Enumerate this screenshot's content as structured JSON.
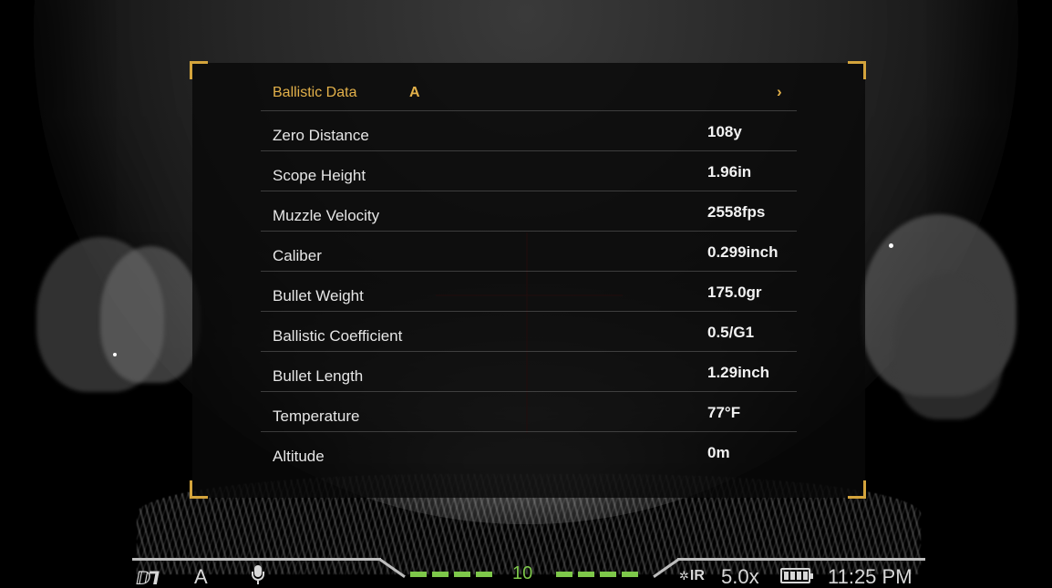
{
  "menu": {
    "title": "Ballistic Data",
    "profile": "A",
    "chevron": "›",
    "rows": [
      {
        "label": "Zero Distance",
        "value": "108y"
      },
      {
        "label": "Scope Height",
        "value": "1.96in"
      },
      {
        "label": "Muzzle Velocity",
        "value": "2558fps"
      },
      {
        "label": "Caliber",
        "value": "0.299inch"
      },
      {
        "label": "Bullet Weight",
        "value": "175.0gr"
      },
      {
        "label": "Ballistic Coefficient",
        "value": "0.5/G1"
      },
      {
        "label": "Bullet Length",
        "value": "1.29inch"
      },
      {
        "label": "Temperature",
        "value": "77°F"
      },
      {
        "label": "Altitude",
        "value": "0m"
      }
    ]
  },
  "status": {
    "brand": "ⅅ⅂",
    "mode": "A",
    "mic_icon": "microphone-icon",
    "range_value": "10",
    "ir_label": "IR",
    "ir_icon": "✲",
    "zoom": "5.0x",
    "battery_icon": "battery-full-icon",
    "battery_level": 1.0,
    "time": "11:25 PM"
  },
  "colors": {
    "accent_gold": "#d4a43c",
    "range_green": "#7ec84a"
  }
}
